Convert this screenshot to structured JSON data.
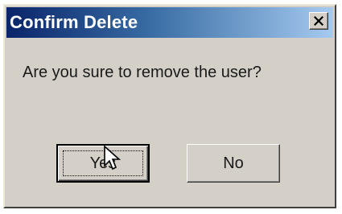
{
  "dialog": {
    "title": "Confirm Delete",
    "close_icon": "close-icon",
    "message": "Are you sure to remove the user?",
    "buttons": {
      "yes_label": "Yes",
      "no_label": "No"
    },
    "cursor_icon": "mouse-pointer-icon"
  },
  "colors": {
    "titlebar_start": "#0a246a",
    "titlebar_end": "#a6caf0",
    "face": "#d4d0c8",
    "title_text": "#ffffff"
  }
}
